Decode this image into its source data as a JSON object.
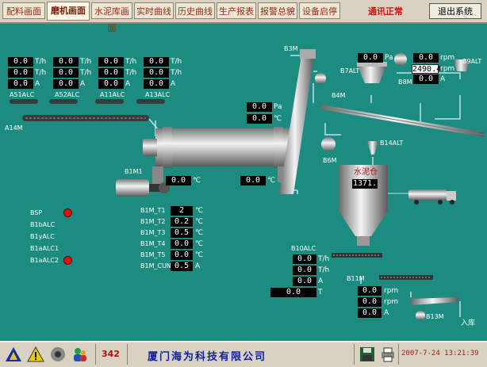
{
  "menu": {
    "tabs": [
      "配料画面",
      "磨机画面",
      "水泥库画面",
      "实时曲线",
      "历史曲线",
      "生产报表",
      "报警总貌",
      "设备启停"
    ],
    "active": "磨机画面",
    "comm_status": "通讯正常",
    "exit_label": "退出系统"
  },
  "feeders": [
    {
      "label": "A51ALC",
      "values": [
        "0.0",
        "0.0",
        "0.0"
      ]
    },
    {
      "label": "A52ALC",
      "values": [
        "0.0",
        "0.0",
        "0.0"
      ]
    },
    {
      "label": "A11ALC",
      "values": [
        "0.0",
        "0.0",
        "0.0"
      ]
    },
    {
      "label": "A13ALC",
      "values": [
        "0.0",
        "0.0",
        "0.0"
      ]
    }
  ],
  "feeder_units": [
    "T/h",
    "T/h",
    "A"
  ],
  "conveyor_label": "A14M",
  "mill": {
    "pa_value": "0.0",
    "pa_unit": "Pa",
    "temp_value": "0.0",
    "temp_unit": "℃",
    "motor_label": "B1M1",
    "motor_temp": "0.0",
    "motor_temp_unit": "℃",
    "outlet_temp": "0.0",
    "outlet_temp_unit": "℃",
    "points": [
      {
        "label": "B1M_T1",
        "value": "2",
        "unit": "℃"
      },
      {
        "label": "B1M_T2",
        "value": "0.2",
        "unit": "℃"
      },
      {
        "label": "B1M_T3",
        "value": "0.5",
        "unit": "℃"
      },
      {
        "label": "B1M_T4",
        "value": "0.0",
        "unit": "℃"
      },
      {
        "label": "B1M_T5",
        "value": "0.0",
        "unit": "℃"
      },
      {
        "label": "B1M_CUN",
        "value": "0.5",
        "unit": "A"
      }
    ]
  },
  "alarms": [
    {
      "label": "BSP",
      "dot": true
    },
    {
      "label": "B1bALC",
      "dot": false
    },
    {
      "label": "B1yALC",
      "dot": false
    },
    {
      "label": "B1aALC1",
      "dot": false
    },
    {
      "label": "B1aALC2",
      "dot": true
    }
  ],
  "elevator_label": "B3M",
  "fan": {
    "label": "B7ALT",
    "value": "0.0",
    "unit": "Pa"
  },
  "separator": {
    "label": "B8M",
    "rpm_value": "0.0",
    "rpm_display": "2490.4",
    "current": "0.0",
    "units": [
      "rpm",
      "rpm",
      "A"
    ]
  },
  "b9_label": "B9ALT",
  "b4_label": "B4M",
  "b6_label": "B6M",
  "b14_label": "B14ALT",
  "silo": {
    "label": "水泥仓",
    "value": "1371."
  },
  "b10": {
    "label": "B10ALC",
    "values": [
      "0.0",
      "0.0",
      "0.0",
      "0.0"
    ],
    "units": [
      "T/h",
      "T/h",
      "A",
      "T"
    ]
  },
  "b11": {
    "label": "B11M",
    "values": [
      "0.0",
      "0.0",
      "0.0"
    ],
    "units": [
      "rpm",
      "rpm",
      "A"
    ]
  },
  "b13_label": "B13M",
  "storage_label": "入库",
  "statusbar": {
    "count": "342",
    "company": "厦门海为科技有限公司",
    "datetime": "2007-7-24 13:21:39"
  },
  "colors": {
    "background": "#1d8c80",
    "pipe": "#bfe0f0",
    "alarm": "#e01010",
    "value_bg": "#000000"
  },
  "icons": [
    "triangle-logo-icon",
    "warning-icon",
    "speaker-icon",
    "users-icon",
    "save-icon",
    "printer-icon"
  ]
}
